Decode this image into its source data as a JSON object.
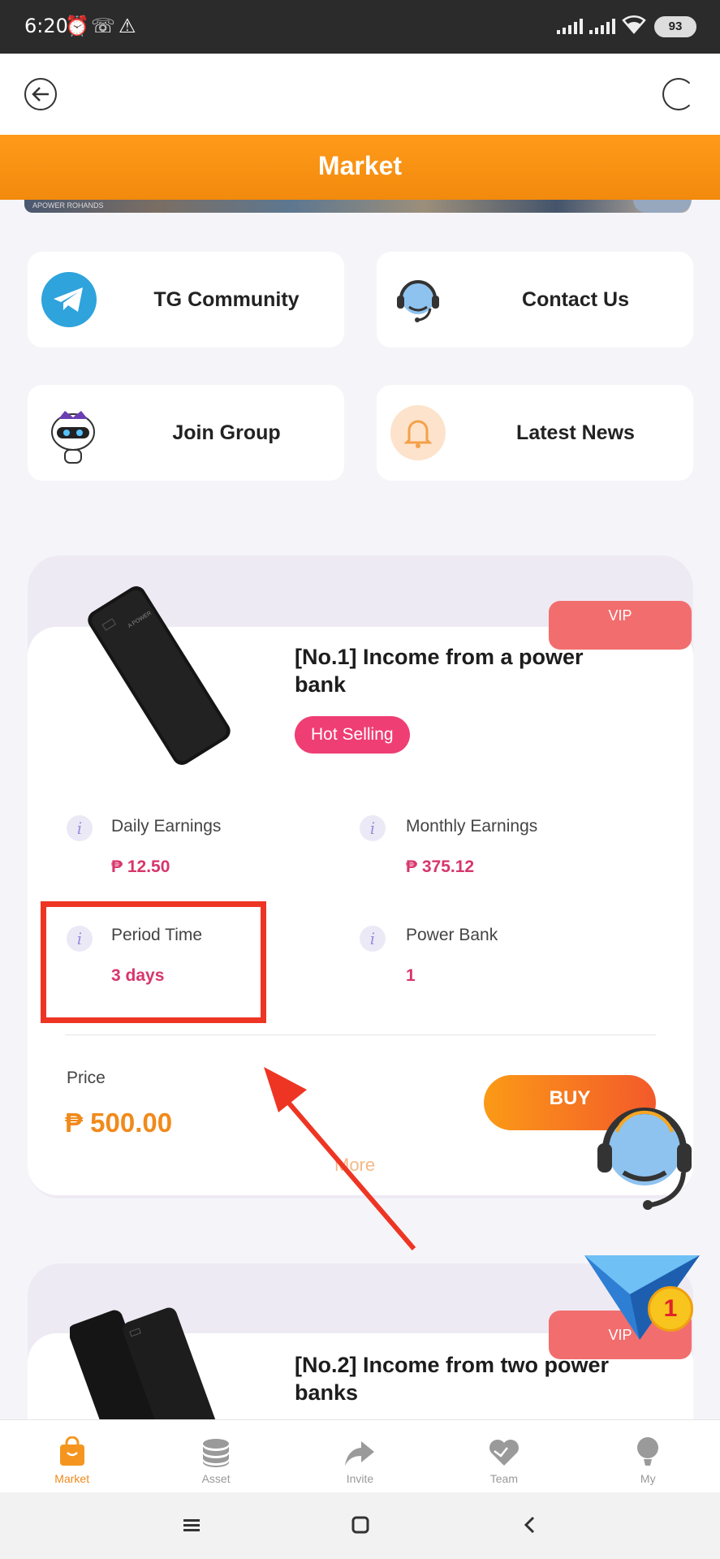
{
  "status_bar": {
    "time": "6:20",
    "battery": "93"
  },
  "header": {
    "title": "Market"
  },
  "banner": {
    "caption": "APOWER ROHANDS"
  },
  "quick_links": [
    {
      "label": "TG Community"
    },
    {
      "label": "Contact Us"
    },
    {
      "label": "Join Group"
    },
    {
      "label": "Latest News"
    }
  ],
  "products": [
    {
      "tag": "VIP",
      "title": "[No.1] Income from a power bank",
      "badge": "Hot Selling",
      "device_label": "A POWER",
      "daily_label": "Daily Earnings",
      "daily_value": "₱ 12.50",
      "monthly_label": "Monthly Earnings",
      "monthly_value": "₱ 375.12",
      "period_label": "Period Time",
      "period_value": "3 days",
      "units_label": "Power Bank",
      "units_value": "1",
      "price_label": "Price",
      "price_value": "₱ 500.00",
      "buy_label": "BUY",
      "more_label": "More"
    },
    {
      "tag": "VIP",
      "title": "[No.2] Income from two power banks",
      "device_label": "A POWER"
    }
  ],
  "floating": {
    "notification_count": "1"
  },
  "bottom_nav": [
    {
      "label": "Market",
      "active": true
    },
    {
      "label": "Asset"
    },
    {
      "label": "Invite"
    },
    {
      "label": "Team"
    },
    {
      "label": "My"
    }
  ],
  "colors": {
    "accent": "#f08a1c",
    "highlight": "#ee3524",
    "value": "#d7366b",
    "badge": "#ef3e74"
  }
}
